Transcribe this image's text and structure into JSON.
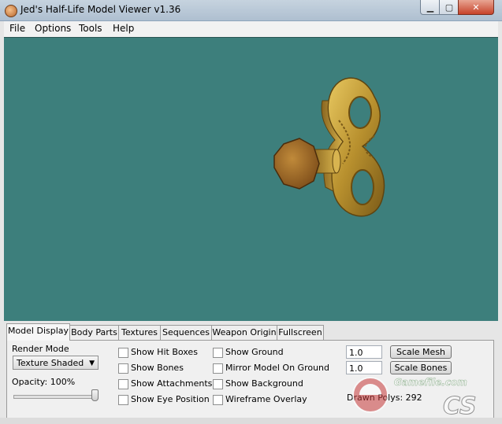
{
  "window": {
    "title": "Jed's Half-Life Model Viewer v1.36",
    "min_glyph": "▁",
    "max_glyph": "▢",
    "close_glyph": "✕"
  },
  "menu": {
    "items": [
      "File",
      "Options",
      "Tools",
      "Help"
    ]
  },
  "tabs": [
    "Model Display",
    "Body Parts",
    "Textures",
    "Sequences",
    "Weapon Origin",
    "Fullscreen"
  ],
  "model_display": {
    "render_mode_label": "Render Mode",
    "render_mode_value": "Texture Shaded",
    "opacity_label": "Opacity: 100%",
    "opacity_value": 1.0,
    "checkboxes_col1": [
      "Show Hit Boxes",
      "Show Bones",
      "Show Attachments",
      "Show Eye Position"
    ],
    "checkboxes_col2": [
      "Show Ground",
      "Mirror Model On Ground",
      "Show Background",
      "Wireframe Overlay"
    ],
    "scale_mesh_value": "1.0",
    "scale_mesh_button": "Scale Mesh",
    "scale_bones_value": "1.0",
    "scale_bones_button": "Scale Bones",
    "drawn_polys": "Drawn Polys: 292"
  },
  "watermark": {
    "line1": "Gamefile.com",
    "line2": "CS"
  },
  "colors": {
    "viewport_bg": "#3d7f7c",
    "model_gold": "#c9a23a"
  }
}
